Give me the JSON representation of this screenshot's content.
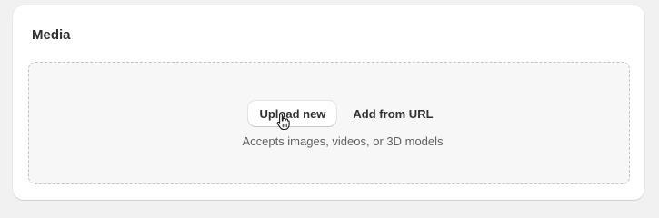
{
  "media": {
    "title": "Media",
    "upload_label": "Upload new",
    "add_url_label": "Add from URL",
    "hint": "Accepts images, videos, or 3D models"
  },
  "icons": {
    "cursor": "hand-pointer-icon"
  }
}
